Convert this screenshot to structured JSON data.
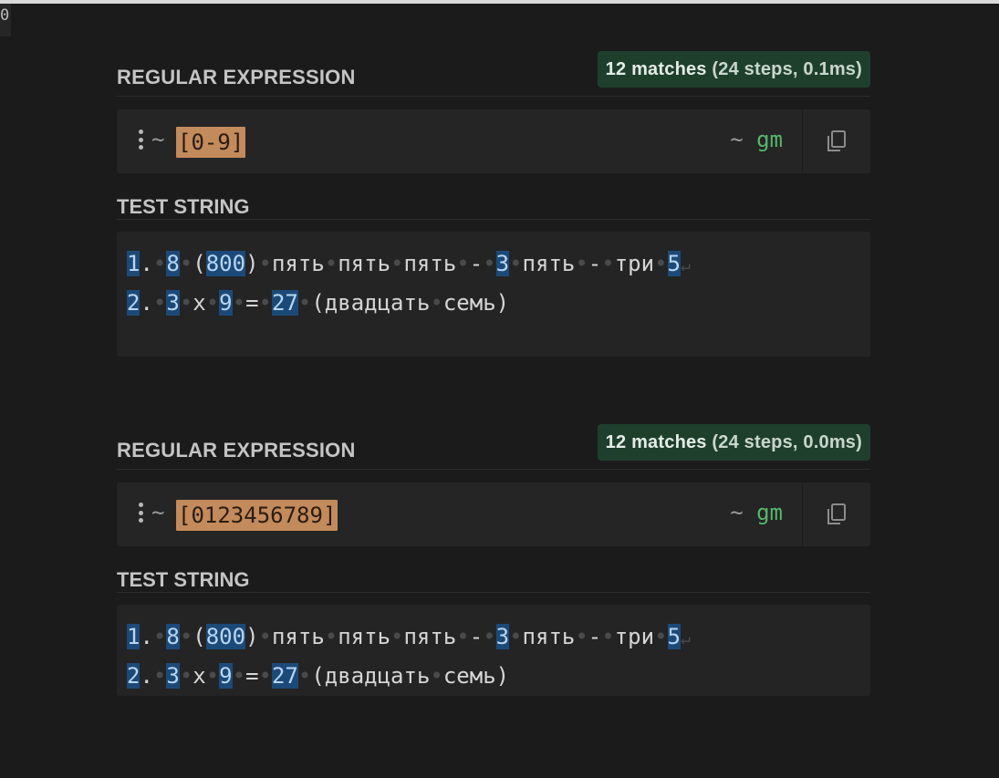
{
  "corner": {
    "text": "0"
  },
  "panels": [
    {
      "regex_title": "REGULAR EXPRESSION",
      "match_count": "12 matches",
      "match_detail": " (24 steps, 0.1ms)",
      "delimiter": "~",
      "pattern": "[0-9]",
      "flags_tilde": "~ ",
      "flags": "gm",
      "test_title": "TEST STRING"
    },
    {
      "regex_title": "REGULAR EXPRESSION",
      "match_count": "12 matches",
      "match_detail": " (24 steps, 0.0ms)",
      "delimiter": "~",
      "pattern": "[0123456789]",
      "flags_tilde": "~ ",
      "flags": "gm",
      "test_title": "TEST STRING"
    }
  ],
  "test_string": {
    "line1": "1. 8 (800) пять пять пять - 3 пять - три 5",
    "line2": "2. 3 x 9 = 27 (двадцать семь)"
  },
  "colors": {
    "match_highlight": "#1c4a78",
    "pattern_highlight": "#c38a5b",
    "flags": "#55b86a",
    "badge_bg": "#1f3f2d"
  },
  "icons": [
    "drag-handle-icon",
    "copy-icon"
  ]
}
